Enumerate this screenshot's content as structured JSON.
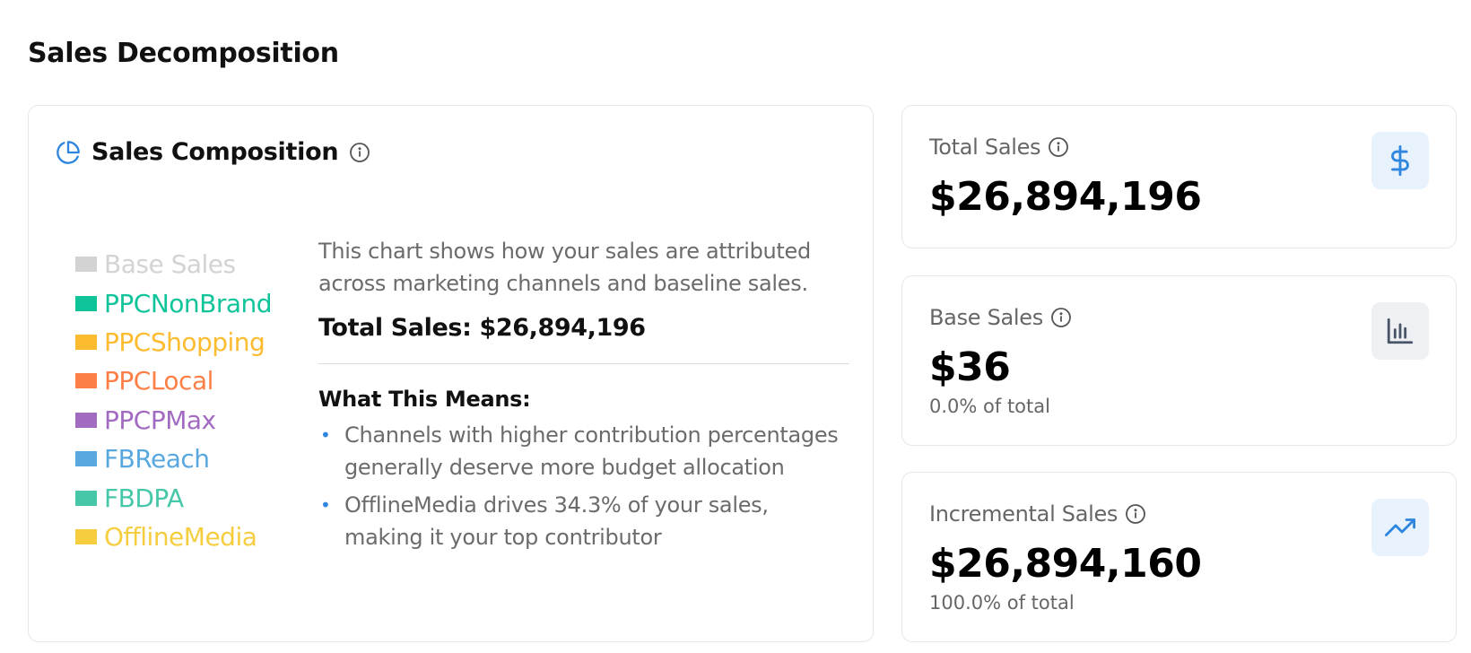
{
  "page": {
    "title": "Sales Decomposition"
  },
  "composition_card": {
    "title": "Sales Composition",
    "icon": "pie-chart-icon",
    "legend": [
      {
        "label": "Base Sales",
        "color": "#d3d3d3"
      },
      {
        "label": "PPCNonBrand",
        "color": "#10c49a"
      },
      {
        "label": "PPCShopping",
        "color": "#fdbb30"
      },
      {
        "label": "PPCLocal",
        "color": "#fe7f46"
      },
      {
        "label": "PPCPMax",
        "color": "#a26bc2"
      },
      {
        "label": "FBReach",
        "color": "#58a8df"
      },
      {
        "label": "FBDPA",
        "color": "#45c7a8"
      },
      {
        "label": "OfflineMedia",
        "color": "#f5cd3f"
      }
    ],
    "description": "This chart shows how your sales are attributed across marketing channels and baseline sales.",
    "total_line": "Total Sales: $26,894,196",
    "means_title": "What This Means:",
    "bullets": [
      "Channels with higher contribution percentages generally deserve more budget allocation",
      "OfflineMedia drives 34.3% of your sales, making it your top contributor"
    ]
  },
  "stats": [
    {
      "label": "Total Sales",
      "value": "$26,894,196",
      "sub": "",
      "icon": "dollar-icon",
      "icon_bg": "#e8f2fc",
      "icon_color": "#2e86de"
    },
    {
      "label": "Base Sales",
      "value": "$36",
      "sub": "0.0% of total",
      "icon": "bar-chart-icon",
      "icon_bg": "#eef0f3",
      "icon_color": "#4a5568"
    },
    {
      "label": "Incremental Sales",
      "value": "$26,894,160",
      "sub": "100.0% of total",
      "icon": "trending-up-icon",
      "icon_bg": "#e8f2fc",
      "icon_color": "#2e86de"
    }
  ]
}
